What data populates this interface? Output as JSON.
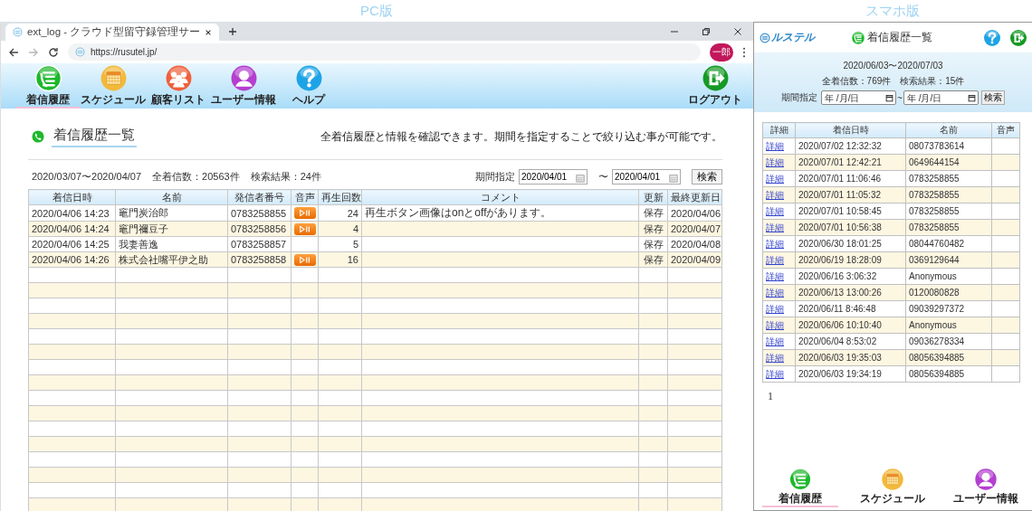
{
  "labels": {
    "pc": "PC版",
    "mobile": "スマホ版"
  },
  "browser": {
    "tab_title": "ext_log - クラウド型留守録管理サー",
    "url": "https://rusutel.jp/",
    "profile": "一郎",
    "can_go_forward": false
  },
  "pc": {
    "nav": [
      {
        "kind": "history",
        "label": "着信履歴",
        "selected": true
      },
      {
        "kind": "schedule",
        "label": "スケジュール",
        "selected": false
      },
      {
        "kind": "customers",
        "label": "顧客リスト",
        "selected": false
      },
      {
        "kind": "user",
        "label": "ユーザー情報",
        "selected": false
      },
      {
        "kind": "help",
        "label": "ヘルプ",
        "selected": false
      }
    ],
    "logout": "ログアウト",
    "heading": "着信履歴一覧",
    "description": "全着信履歴と情報を確認できます。期間を指定することで絞り込む事が可能です。",
    "summary": {
      "period": "2020/03/07〜2020/04/07",
      "total": "全着信数：20563件",
      "results": "検索結果：24件"
    },
    "filter": {
      "label": "期間指定",
      "from": "2020/04/01",
      "separator": "〜",
      "to": "2020/04/01",
      "button": "検索"
    },
    "table": {
      "columns": [
        "着信日時",
        "名前",
        "発信者番号",
        "音声",
        "再生回数",
        "コメント",
        "更新",
        "最終更新日"
      ],
      "rows": [
        {
          "datetime": "2020/04/06 14:23",
          "name": "竈門炭治郎",
          "number": "0783258855",
          "audio": true,
          "plays": "24",
          "comment": "再生ボタン画像はonとoffがあります。",
          "update": "保存",
          "updated": "2020/04/06"
        },
        {
          "datetime": "2020/04/06 14:24",
          "name": "竈門禰豆子",
          "number": "0783258856",
          "audio": true,
          "plays": "4",
          "update": "保存",
          "updated": "2020/04/07"
        },
        {
          "datetime": "2020/04/06 14:25",
          "name": "我妻善逸",
          "number": "0783258857",
          "audio": false,
          "plays": "5",
          "update": "保存",
          "updated": "2020/04/08"
        },
        {
          "datetime": "2020/04/06 14:26",
          "name": "株式会社嘴平伊之助",
          "number": "0783258858",
          "audio": true,
          "plays": "16",
          "update": "保存",
          "updated": "2020/04/09"
        }
      ]
    }
  },
  "mobile": {
    "logo": "ルステル",
    "title": "着信履歴一覧",
    "period": "2020/06/03〜2020/07/03",
    "summary": {
      "total": "全着信数：769件",
      "results": "検索結果：15件"
    },
    "filter": {
      "label": "期間指定",
      "from_placeholder": "年 /月/日",
      "separator": "~",
      "to_placeholder": "年 /月/日",
      "button": "検索"
    },
    "table": {
      "columns": [
        "詳細",
        "着信日時",
        "名前",
        "音声"
      ],
      "rows": [
        {
          "link": "詳細",
          "datetime": "2020/07/02 12:32:32",
          "name": "08073783614"
        },
        {
          "link": "詳細",
          "datetime": "2020/07/01 12:42:21",
          "name": "0649644154"
        },
        {
          "link": "詳細",
          "datetime": "2020/07/01 11:06:46",
          "name": "0783258855"
        },
        {
          "link": "詳細",
          "datetime": "2020/07/01 11:05:32",
          "name": "0783258855"
        },
        {
          "link": "詳細",
          "datetime": "2020/07/01 10:58:45",
          "name": "0783258855"
        },
        {
          "link": "詳細",
          "datetime": "2020/07/01 10:56:38",
          "name": "0783258855"
        },
        {
          "link": "詳細",
          "datetime": "2020/06/30 18:01:25",
          "name": "08044760482"
        },
        {
          "link": "詳細",
          "datetime": "2020/06/19 18:28:09",
          "name": "0369129644"
        },
        {
          "link": "詳細",
          "datetime": "2020/06/16 3:06:32",
          "name": "Anonymous"
        },
        {
          "link": "詳細",
          "datetime": "2020/06/13 13:00:26",
          "name": "0120080828"
        },
        {
          "link": "詳細",
          "datetime": "2020/06/11 8:46:48",
          "name": "09039297372"
        },
        {
          "link": "詳細",
          "datetime": "2020/06/06 10:10:40",
          "name": "Anonymous"
        },
        {
          "link": "詳細",
          "datetime": "2020/06/04 8:53:02",
          "name": "09036278334"
        },
        {
          "link": "詳細",
          "datetime": "2020/06/03 19:35:03",
          "name": "08056394885"
        },
        {
          "link": "詳細",
          "datetime": "2020/06/03 19:34:19",
          "name": "08056394885"
        }
      ]
    },
    "pages": [
      "1"
    ],
    "nav": [
      {
        "kind": "history",
        "label": "着信履歴",
        "selected": true
      },
      {
        "kind": "schedule",
        "label": "スケジュール",
        "selected": false
      },
      {
        "kind": "user",
        "label": "ユーザー情報",
        "selected": false
      }
    ]
  }
}
